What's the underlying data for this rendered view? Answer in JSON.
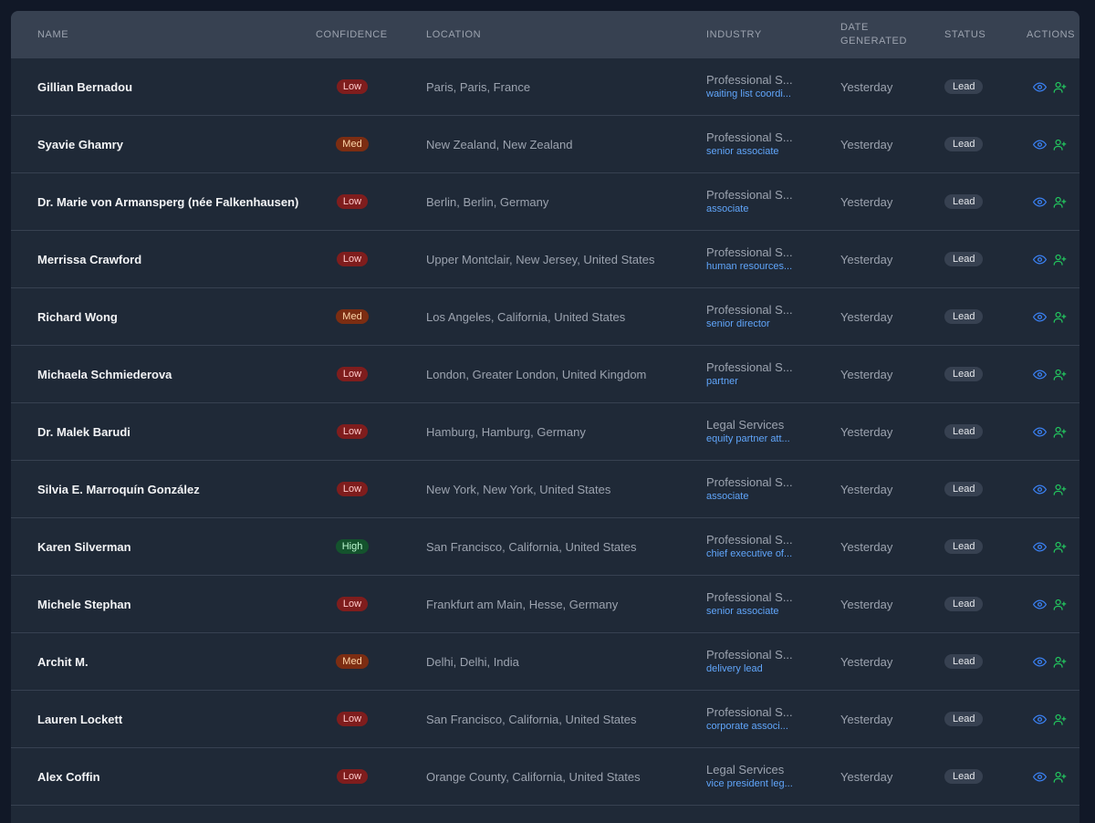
{
  "table": {
    "columns": {
      "name": "NAME",
      "confidence": "CONFIDENCE",
      "location": "LOCATION",
      "industry": "INDUSTRY",
      "date_line1": "DATE",
      "date_line2": "GENERATED",
      "status": "STATUS",
      "actions": "ACTIONS"
    },
    "rows": [
      {
        "name": "Gillian Bernadou",
        "confidence": "Low",
        "location": "Paris, Paris, France",
        "industry": "Professional S...",
        "role": "waiting list coordi...",
        "date": "Yesterday",
        "status": "Lead"
      },
      {
        "name": "Syavie Ghamry",
        "confidence": "Med",
        "location": "New Zealand, New Zealand",
        "industry": "Professional S...",
        "role": "senior associate",
        "date": "Yesterday",
        "status": "Lead"
      },
      {
        "name": "Dr. Marie von Armansperg (née Falkenhausen)",
        "confidence": "Low",
        "location": "Berlin, Berlin, Germany",
        "industry": "Professional S...",
        "role": "associate",
        "date": "Yesterday",
        "status": "Lead"
      },
      {
        "name": "Merrissa Crawford",
        "confidence": "Low",
        "location": "Upper Montclair, New Jersey, United States",
        "industry": "Professional S...",
        "role": "human resources...",
        "date": "Yesterday",
        "status": "Lead"
      },
      {
        "name": "Richard Wong",
        "confidence": "Med",
        "location": "Los Angeles, California, United States",
        "industry": "Professional S...",
        "role": "senior director",
        "date": "Yesterday",
        "status": "Lead"
      },
      {
        "name": "Michaela Schmiederova",
        "confidence": "Low",
        "location": "London, Greater London, United Kingdom",
        "industry": "Professional S...",
        "role": "partner",
        "date": "Yesterday",
        "status": "Lead"
      },
      {
        "name": "Dr. Malek Barudi",
        "confidence": "Low",
        "location": "Hamburg, Hamburg, Germany",
        "industry": "Legal Services",
        "role": "equity partner att...",
        "date": "Yesterday",
        "status": "Lead"
      },
      {
        "name": "Silvia E. Marroquín González",
        "confidence": "Low",
        "location": "New York, New York, United States",
        "industry": "Professional S...",
        "role": "associate",
        "date": "Yesterday",
        "status": "Lead"
      },
      {
        "name": "Karen Silverman",
        "confidence": "High",
        "location": "San Francisco, California, United States",
        "industry": "Professional S...",
        "role": "chief executive of...",
        "date": "Yesterday",
        "status": "Lead"
      },
      {
        "name": "Michele Stephan",
        "confidence": "Low",
        "location": "Frankfurt am Main, Hesse, Germany",
        "industry": "Professional S...",
        "role": "senior associate",
        "date": "Yesterday",
        "status": "Lead"
      },
      {
        "name": "Archit M.",
        "confidence": "Med",
        "location": "Delhi, Delhi, India",
        "industry": "Professional S...",
        "role": "delivery lead",
        "date": "Yesterday",
        "status": "Lead"
      },
      {
        "name": "Lauren Lockett",
        "confidence": "Low",
        "location": "San Francisco, California, United States",
        "industry": "Professional S...",
        "role": "corporate associ...",
        "date": "Yesterday",
        "status": "Lead"
      },
      {
        "name": "Alex Coffin",
        "confidence": "Low",
        "location": "Orange County, California, United States",
        "industry": "Legal Services",
        "role": "vice president leg...",
        "date": "Yesterday",
        "status": "Lead"
      }
    ],
    "actions": {
      "view_icon": "eye-icon",
      "add_icon": "user-plus-icon"
    }
  },
  "colors": {
    "page_bg": "#111827",
    "table_bg": "#1f2937",
    "header_bg": "#374151",
    "low": "#7f1d1d",
    "med": "#7c2d12",
    "high": "#14532d",
    "link": "#60a5fa",
    "add_icon": "#22c55e",
    "view_icon": "#3b82f6"
  }
}
